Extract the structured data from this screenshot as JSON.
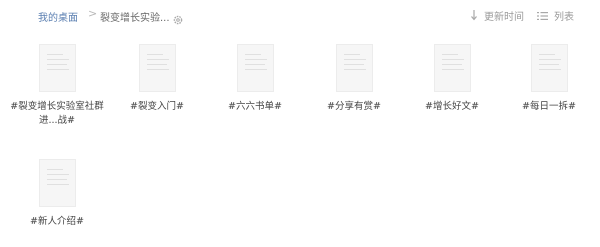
{
  "breadcrumb": {
    "root": "我的桌面",
    "separator": ">",
    "current": "裂变增长实验..."
  },
  "toolbar": {
    "sort_label": "更新时间",
    "view_label": "列表"
  },
  "files": [
    {
      "name": "#裂变增长实验室社群进...战#"
    },
    {
      "name": "#裂变入门#"
    },
    {
      "name": "#六六书单#"
    },
    {
      "name": "#分享有赏#"
    },
    {
      "name": "#增长好文#"
    },
    {
      "name": "#每日一拆#"
    },
    {
      "name": "#新人介绍#"
    }
  ]
}
